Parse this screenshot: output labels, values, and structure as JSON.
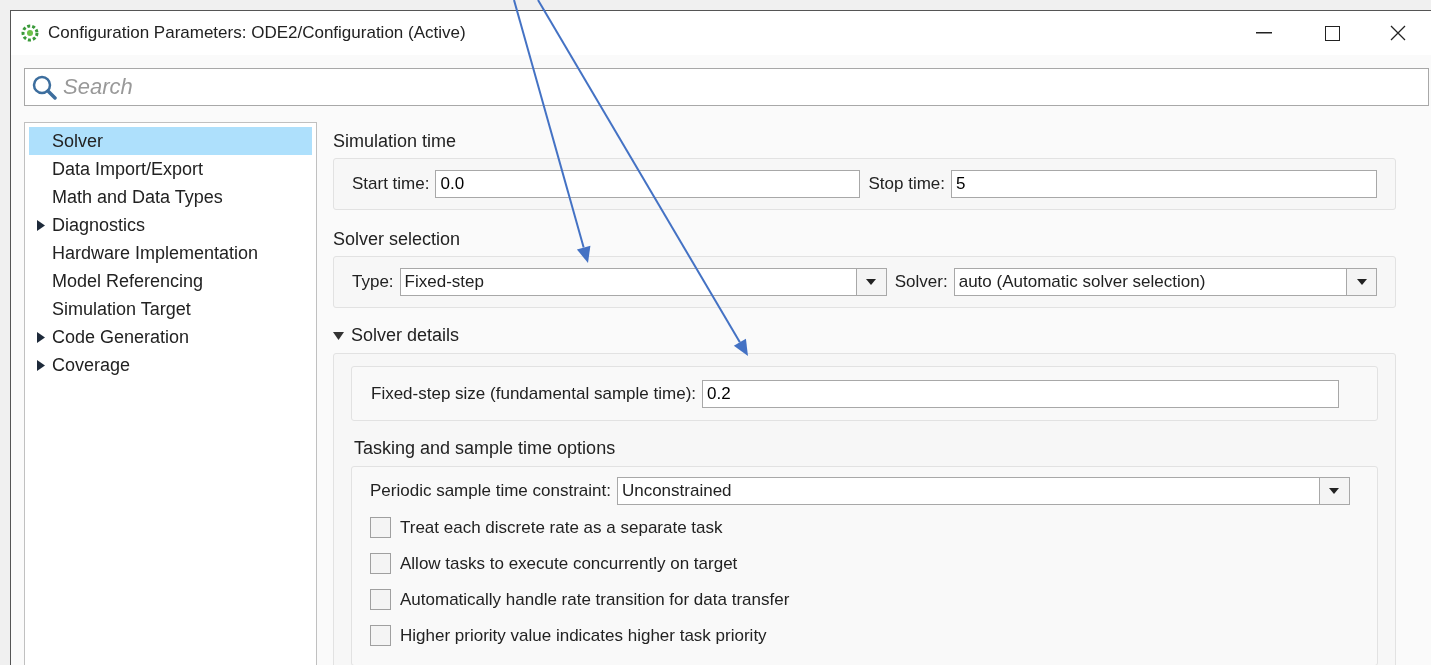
{
  "window": {
    "title": "Configuration Parameters: ODE2/Configuration (Active)"
  },
  "search": {
    "placeholder": "Search"
  },
  "sidebar": {
    "items": [
      {
        "label": "Solver",
        "kind": "page",
        "selected": true
      },
      {
        "label": "Data Import/Export",
        "kind": "page",
        "selected": false
      },
      {
        "label": "Math and Data Types",
        "kind": "page",
        "selected": false
      },
      {
        "label": "Diagnostics",
        "kind": "group",
        "selected": false
      },
      {
        "label": "Hardware Implementation",
        "kind": "page",
        "selected": false
      },
      {
        "label": "Model Referencing",
        "kind": "page",
        "selected": false
      },
      {
        "label": "Simulation Target",
        "kind": "page",
        "selected": false
      },
      {
        "label": "Code Generation",
        "kind": "group",
        "selected": false
      },
      {
        "label": "Coverage",
        "kind": "group",
        "selected": false
      }
    ]
  },
  "simulation_time": {
    "title": "Simulation time",
    "start_label": "Start time:",
    "start_value": "0.0",
    "stop_label": "Stop time:",
    "stop_value": "5"
  },
  "solver_selection": {
    "title": "Solver selection",
    "type_label": "Type:",
    "type_value": "Fixed-step",
    "solver_label": "Solver:",
    "solver_value": "auto (Automatic solver selection)"
  },
  "solver_details": {
    "title": "Solver details",
    "expanded": true,
    "step_label": "Fixed-step size (fundamental sample time):",
    "step_value": "0.2",
    "tasking": {
      "title": "Tasking and sample time options",
      "constraint_label": "Periodic sample time constraint:",
      "constraint_value": "Unconstrained",
      "options": [
        {
          "label": "Treat each discrete rate as a separate task",
          "checked": false
        },
        {
          "label": "Allow tasks to execute concurrently on target",
          "checked": false
        },
        {
          "label": "Automatically handle rate transition for data transfer",
          "checked": false
        },
        {
          "label": "Higher priority value indicates higher task priority",
          "checked": false
        }
      ]
    }
  }
}
